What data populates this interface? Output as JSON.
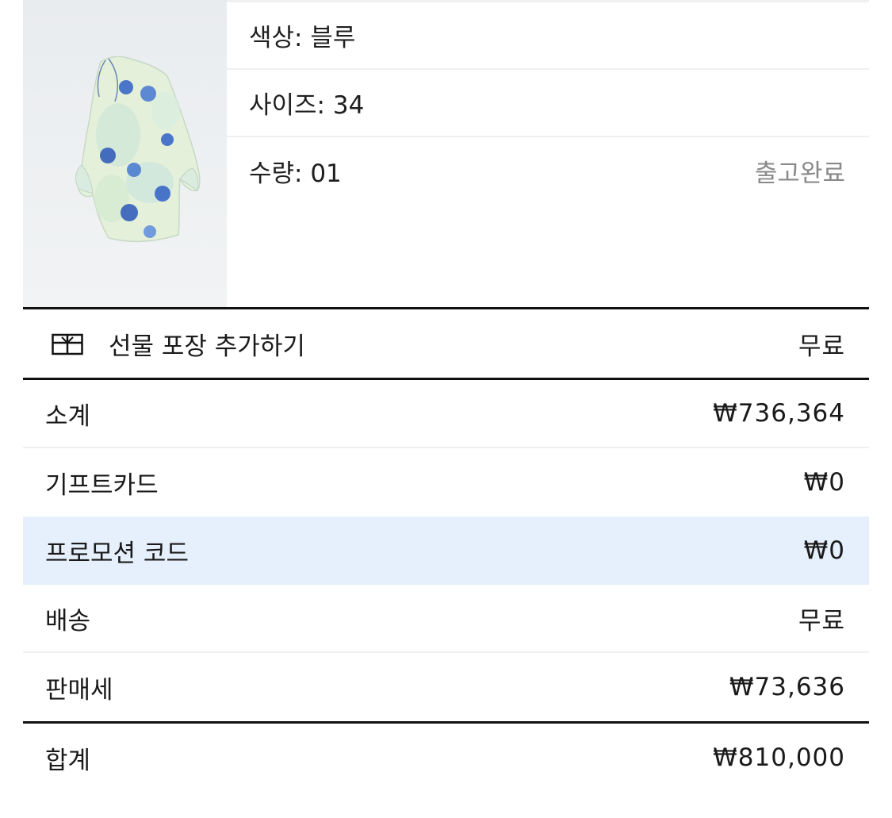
{
  "product": {
    "image_alt": "블루 플로럴 프린트 미니 드레스",
    "color": "색상: 블루",
    "size": "사이즈: 34",
    "quantity": "수량: 01",
    "status": "출고완료"
  },
  "gift_wrap": {
    "icon": "gift-box-icon",
    "label": "선물 포장 추가하기",
    "price": "무료"
  },
  "summary": {
    "subtotal": {
      "label": "소계",
      "value": "₩736,364"
    },
    "gift_card": {
      "label": "기프트카드",
      "value": "₩0"
    },
    "promo_code": {
      "label": "프로모션 코드",
      "value": "₩0"
    },
    "shipping": {
      "label": "배송",
      "value": "무료"
    },
    "sales_tax": {
      "label": "판매세",
      "value": "₩73,636"
    },
    "total": {
      "label": "합계",
      "value": "₩810,000"
    }
  },
  "colors": {
    "highlight": "#e6effc",
    "status_gray": "#8a8a8a",
    "dress_blue": "#2f5fc4"
  }
}
